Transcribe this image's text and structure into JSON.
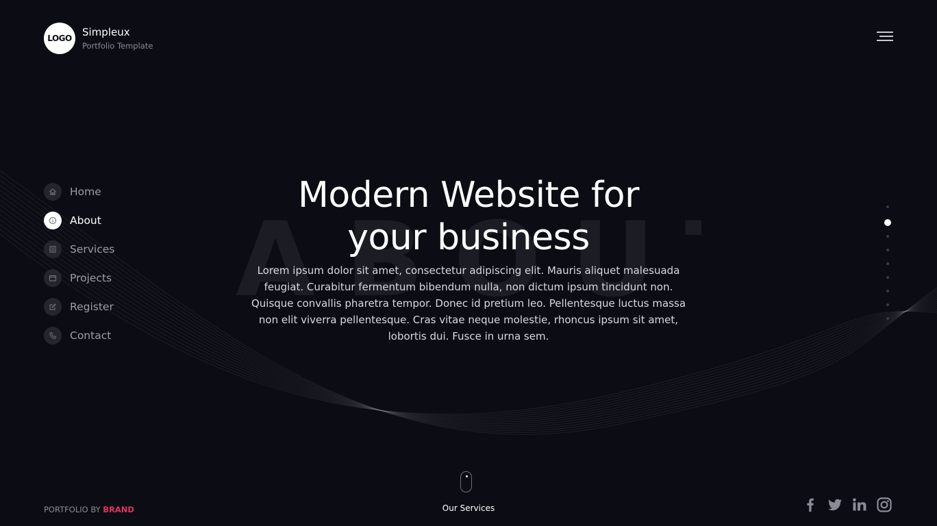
{
  "header": {
    "logo_text": "LOGO",
    "brand_name": "Simpleux",
    "brand_sub": "Portfolio Template"
  },
  "nav": {
    "items": [
      {
        "label": "Home",
        "icon": "home-icon"
      },
      {
        "label": "About",
        "icon": "info-icon",
        "active": true
      },
      {
        "label": "Services",
        "icon": "list-icon"
      },
      {
        "label": "Projects",
        "icon": "folder-icon"
      },
      {
        "label": "Register",
        "icon": "edit-icon"
      },
      {
        "label": "Contact",
        "icon": "phone-icon"
      }
    ]
  },
  "hero": {
    "background_word": "ABOUT",
    "title_line1": "Modern Website for",
    "title_line2": "your business",
    "text": "Lorem ipsum dolor sit amet, consectetur adipiscing elit. Mauris aliquet malesuada feugiat. Curabitur fermentum bibendum nulla, non dictum ipsum tincidunt non. Quisque convallis pharetra tempor. Donec id pretium leo. Pellentesque luctus massa non elit viverra pellentesque. Cras vitae neque molestie, rhoncus ipsum sit amet, lobortis dui. Fusce in urna sem."
  },
  "pager": {
    "total": 9,
    "active_index": 1
  },
  "scroll": {
    "label": "Our Services"
  },
  "footer": {
    "credit_prefix": "PORTFOLIO BY ",
    "credit_brand": "BRAND",
    "social": [
      "facebook-icon",
      "twitter-icon",
      "linkedin-icon",
      "instagram-icon"
    ]
  },
  "colors": {
    "background": "#0c0d14",
    "accent": "#e0345f",
    "muted_text": "#9c9da5"
  }
}
